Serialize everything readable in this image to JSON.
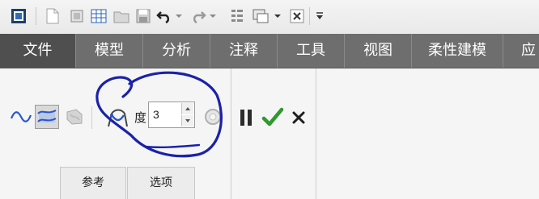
{
  "quick_access": {
    "icons": [
      "app-icon",
      "new-file-icon",
      "open-icon",
      "regenerate-icon",
      "open-folder-icon",
      "save-icon",
      "undo-icon",
      "undo-dropdown-icon",
      "redo-icon",
      "redo-dropdown-icon",
      "regen-list-icon",
      "window-icon",
      "window-dropdown-icon",
      "close-window-icon",
      "customize-dropdown-icon"
    ]
  },
  "ribbon": {
    "tabs": [
      {
        "label": "文件",
        "active": true
      },
      {
        "label": "模型"
      },
      {
        "label": "分析"
      },
      {
        "label": "注释"
      },
      {
        "label": "工具"
      },
      {
        "label": "视图"
      },
      {
        "label": "柔性建模"
      },
      {
        "label": "应"
      }
    ]
  },
  "sweep_panel": {
    "degree_label": "度",
    "degree_value": "3",
    "subtabs": [
      {
        "label": "参考"
      },
      {
        "label": "选项"
      }
    ]
  },
  "colors": {
    "tab_bar": "#6e6e6e",
    "tab_active": "#4f4f4f",
    "accept_green": "#2e9a2e",
    "annotation_blue": "#1b22a8"
  }
}
